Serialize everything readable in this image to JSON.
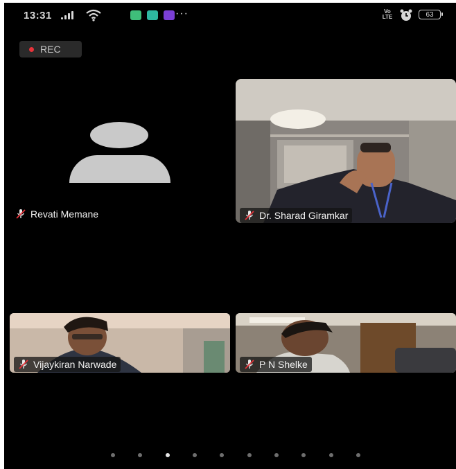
{
  "status_bar": {
    "time": "13:31",
    "volte": "Vo LTE",
    "battery": "63",
    "more": "···",
    "app_colors": [
      "#3fbf7a",
      "#2eb8a0",
      "#7b3fd6"
    ]
  },
  "recording": {
    "label": "REC",
    "dot_color": "#e8333a"
  },
  "participants": [
    {
      "name": "Revati Memane",
      "muted": true,
      "video": false
    },
    {
      "name": "Dr. Sharad Giramkar",
      "muted": true,
      "video": true
    },
    {
      "name": "Vijaykiran Narwade",
      "muted": true,
      "video": true
    },
    {
      "name": "P N Shelke",
      "muted": true,
      "video": true
    }
  ],
  "pager": {
    "total": 10,
    "active": 3
  }
}
